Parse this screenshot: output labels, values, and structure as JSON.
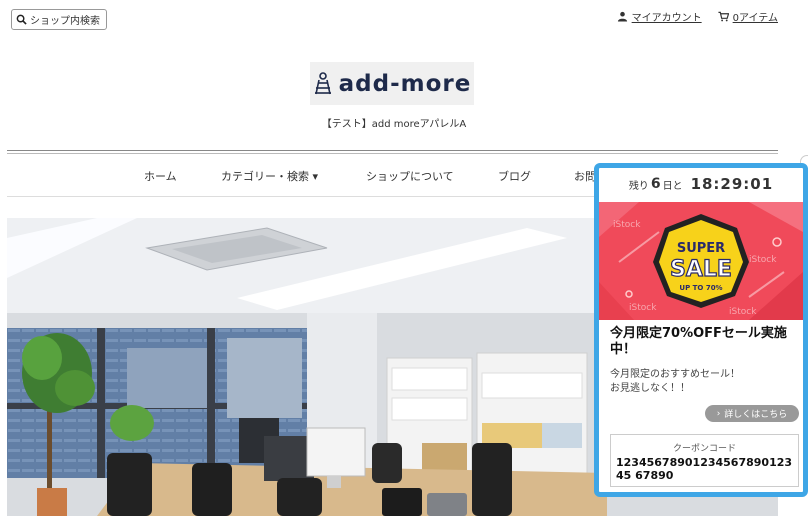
{
  "header": {
    "shop_search_label": "ショップ内検索",
    "my_account_label": "マイアカウント",
    "cart_label": "0アイテム"
  },
  "brand": {
    "logo_text": "add-more",
    "tagline": "【テスト】add moreアパレルA",
    "logo_color": "#1e2a4a"
  },
  "nav": {
    "items": [
      {
        "label": "ホーム"
      },
      {
        "label": "カテゴリー・検索 ▾"
      },
      {
        "label": "ショップについて"
      },
      {
        "label": "ブログ"
      },
      {
        "label": "お問"
      }
    ]
  },
  "popup": {
    "accent_color": "#3ea6e6",
    "countdown": {
      "prefix": "残り",
      "days": "6",
      "days_suffix": "日と",
      "time": "18:29:01"
    },
    "banner": {
      "line1": "SUPER",
      "line2": "SALE",
      "line3": "UP TO 70%",
      "watermark": "iStock",
      "background_color": "#f04a5a",
      "badge_color": "#f7d21a"
    },
    "title": "今月限定70%OFFセール実施中！",
    "body_line1": "今月限定のおすすめセール！",
    "body_line2": "お見逃しなく！！",
    "details_button": "詳しくはこちら",
    "coupon_label": "クーポンコード",
    "coupon_code": "1234567890123456789012345 67890"
  }
}
